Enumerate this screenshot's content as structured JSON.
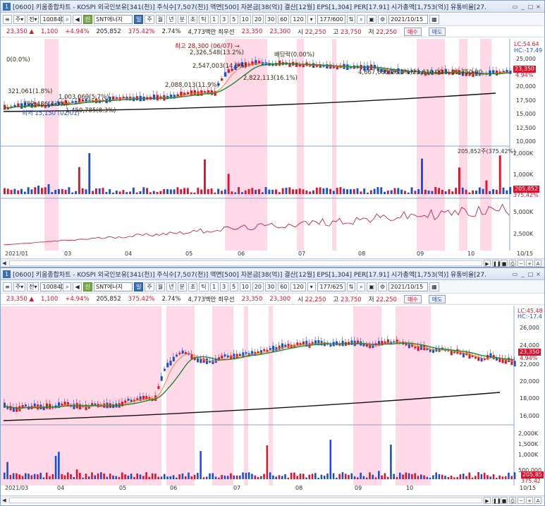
{
  "window_top": {
    "number": "1",
    "title": "[0600] 키움종합차트 - KOSPI 외국인보유[341(천)] 주식수[7,507(천)] 액면[500] 자본금[38(억)] 결산[12월] EPS[1,304] PER[17.91] 시가총액[1,753(억)] 유통비율[27.",
    "toolbar": {
      "code": "100840",
      "stock_name": "SNT에너지",
      "periods": [
        "일",
        "주",
        "월",
        "년",
        "분",
        "초",
        "틱"
      ],
      "minutes": [
        "1",
        "3",
        "5",
        "10",
        "20",
        "30",
        "60",
        "120"
      ],
      "counter": "177/600",
      "date": "2021/10/15"
    },
    "price": {
      "last": "23,350",
      "arrow": "▲",
      "change": "1,100",
      "pct": "+4.94%",
      "volume": "205,852",
      "vol_pct": "375.42%",
      "turnover": "2.74%",
      "amount": "4,773백만",
      "best_label": "최우선",
      "bid": "23,350",
      "ask": "23,300",
      "open_label": "시",
      "open": "22,250",
      "high_label": "고",
      "high": "23,750",
      "low_label": "저",
      "low": "22,250",
      "buy": "매수",
      "sell": "매도"
    },
    "annotations": {
      "peak": "최고 28,300 (06/07) →",
      "dividend": "배당락(0.00%)",
      "a1": "0(0.0%)",
      "a2": "2,326,548(13.2%)",
      "a3": "2,547,003(14.5%)",
      "a4": "2,822,113(16.1%)",
      "a5": "2,088,013(11.9%)",
      "a6": "4,667,685(26.5%)23,610.00 ~ 22,750.00",
      "a7": "321,061(1.8%)",
      "a8": "1,003,069(5.7%)",
      "a9": "792,486(4.5%)",
      "a10": "1,450,785(8.3%)",
      "low_ann": "최저 15,150 (02/01)"
    },
    "y_labels": [
      "25,000",
      "22,500",
      "20,000",
      "17,500",
      "15,000",
      "12,500",
      "10,000"
    ],
    "lc": "LC:54.64",
    "hc": "HC:-17.49",
    "price_tag": "23,350",
    "price_pct_tag": "4.94%",
    "vol_labels": [
      "2,000K",
      "1,000K"
    ],
    "vol_note": "205,852주(375.42%)",
    "vol_tag": "205,852",
    "vol_tag_pct": "375.42%",
    "ind_labels": [
      "5,000K",
      "2,500K"
    ],
    "x_labels": [
      "2021/01",
      "03",
      "04",
      "05",
      "06",
      "07",
      "08",
      "09",
      "10",
      "10/15"
    ]
  },
  "window_bottom": {
    "number": "1",
    "title": "[0600] 키움종합차트 - KOSPI 외국인보유[341(천)] 주식수[7,507(천)] 액면[500] 자본금[38(억)] 결산[12월] EPS[1,304] PER[17.91] 시가총액[1,753(억)] 유통비율[27.",
    "counter": "177/625",
    "lc": "LC:45.48",
    "hc": "HC:-17.4",
    "y_labels": [
      "26,000",
      "24,000",
      "22,000",
      "20,000",
      "18,000",
      "16,000"
    ],
    "price_tag": "23,350",
    "price_pct_tag": "4.94%",
    "vol_labels": [
      "2,000K",
      "1,500K",
      "1,000K",
      "500,000"
    ],
    "vol_tag": "205,85",
    "vol_tag_pct": "375.42",
    "x_labels": [
      "2021/03",
      "04",
      "05",
      "06",
      "07",
      "08",
      "09",
      "10",
      "10/15"
    ]
  },
  "colors": {
    "up": "#e0112b",
    "down": "#1a4ed1",
    "pink": "#ffd6e6",
    "accent": "#3b6fb5"
  },
  "icons": [
    "search-icon",
    "settings-icon",
    "print-icon",
    "save-icon",
    "zoom-in-icon",
    "zoom-out-icon",
    "play-icon",
    "pause-icon",
    "stop-icon"
  ]
}
